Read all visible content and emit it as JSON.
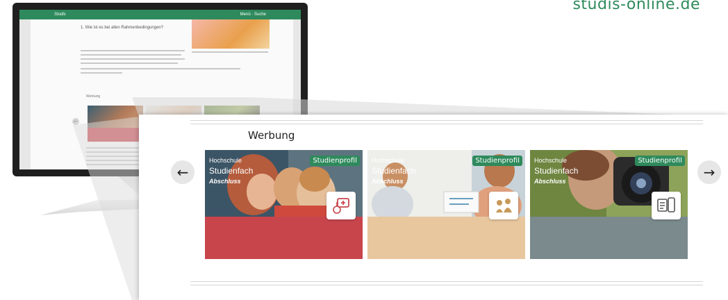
{
  "brand": "studis-online.de",
  "ad_label": "Werbung",
  "nav": {
    "prev_arrow": "←",
    "next_arrow": "→"
  },
  "mini": {
    "logo": "Studis",
    "title": "1. Wie ist es bei allen Rahmenbedingungen?",
    "menu": "Menü  ·  Suche"
  },
  "cards": [
    {
      "badge": "Studienprofil",
      "university": "Hochschule",
      "subject": "Studienfach",
      "degree": "Abschluss",
      "icon": "doctor-case-icon",
      "footer_color": "#c8454c"
    },
    {
      "badge": "Studienprofil",
      "university": "Hochschule",
      "subject": "Studienfach",
      "degree": "Abschluss",
      "icon": "teacher-student-icon",
      "footer_color": "#e8c79e"
    },
    {
      "badge": "Studienprofil",
      "university": "Hochschule",
      "subject": "Studienfach",
      "degree": "Abschluss",
      "icon": "media-devices-icon",
      "footer_color": "#7b8a8c"
    }
  ],
  "colors": {
    "accent": "#2e8a5c"
  }
}
